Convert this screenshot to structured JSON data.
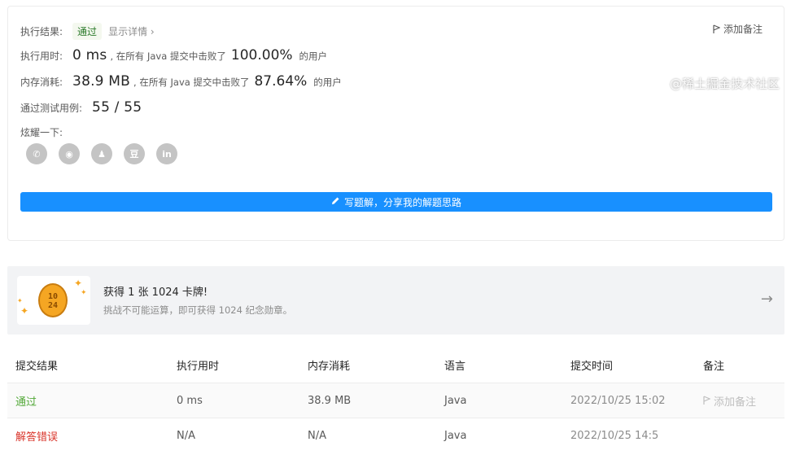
{
  "result": {
    "status_label": "执行结果:",
    "status_value": "通过",
    "detail_link": "显示详情 ›",
    "add_note": "添加备注",
    "runtime": {
      "label": "执行用时:",
      "value": "0 ms",
      "middle": ", 在所有 Java 提交中击败了",
      "percent": "100.00%",
      "suffix": "的用户"
    },
    "memory": {
      "label": "内存消耗:",
      "value": "38.9 MB",
      "middle": ", 在所有 Java 提交中击败了",
      "percent": "87.64%",
      "suffix": "的用户"
    },
    "tests": {
      "label": "通过测试用例:",
      "value": "55 / 55"
    },
    "share_label": "炫耀一下:",
    "share_icons": [
      "wechat-icon",
      "weibo-icon",
      "qq-icon",
      "douban-icon",
      "linkedin-icon"
    ],
    "share_glyphs": [
      "✆",
      "◉",
      "♟",
      "豆",
      "in"
    ],
    "write_button": "写题解，分享我的解题思路"
  },
  "banner": {
    "title": "获得 1 张 1024 卡牌!",
    "subtitle": "挑战不可能运算，即可获得 1024 纪念勋章。",
    "coin_text_1": "10",
    "coin_text_2": "24"
  },
  "table": {
    "headers": [
      "提交结果",
      "执行用时",
      "内存消耗",
      "语言",
      "提交时间",
      "备注"
    ],
    "rows": [
      {
        "result": "通过",
        "runtime": "0 ms",
        "memory": "38.9 MB",
        "language": "Java",
        "time": "2022/10/25 15:02",
        "note": "添加备注"
      },
      {
        "result": "解答错误",
        "runtime": "N/A",
        "memory": "N/A",
        "language": "Java",
        "time": "2022/10/25 14:5",
        "note": ""
      }
    ]
  },
  "watermark": "@稀土掘金技术社区",
  "colors": {
    "accent": "#1890ff",
    "pass": "#52a838",
    "fail": "#d9342a"
  }
}
